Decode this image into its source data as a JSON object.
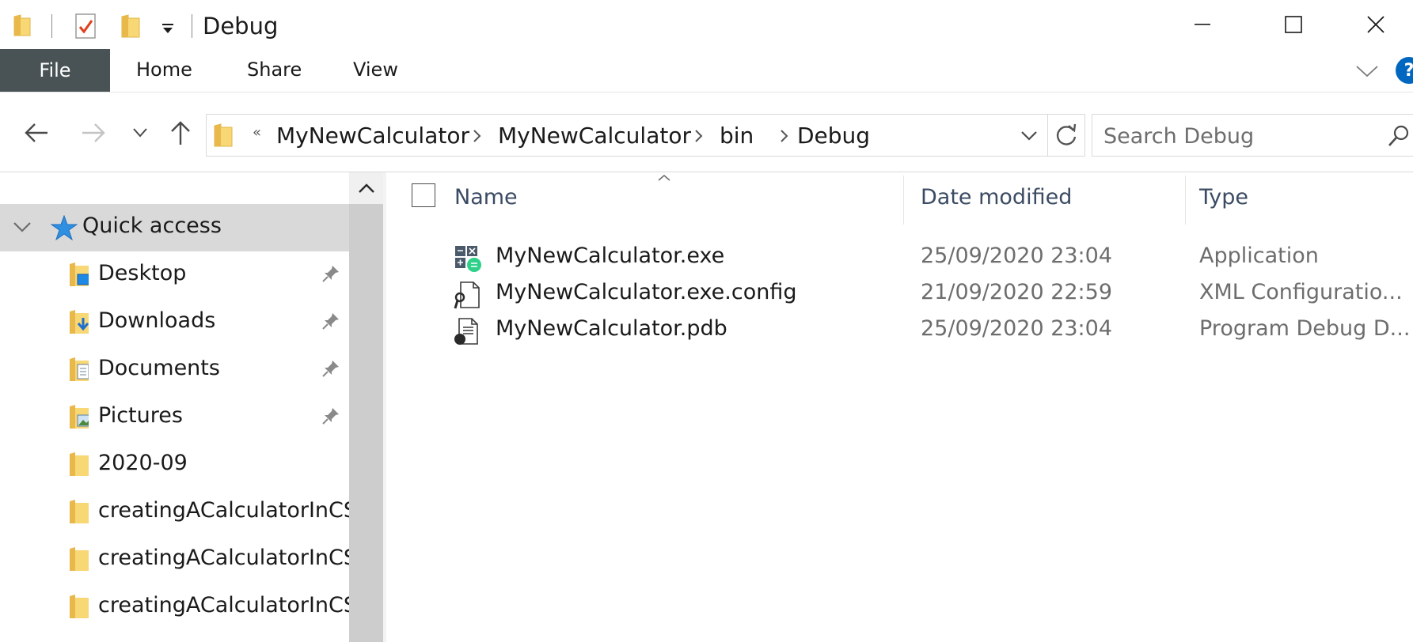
{
  "window": {
    "title": "Debug",
    "minimize_glyph": "—",
    "maximize_glyph": "☐",
    "close_glyph": "✕"
  },
  "ribbon": {
    "tabs": [
      {
        "label": "File"
      },
      {
        "label": "Home"
      },
      {
        "label": "Share"
      },
      {
        "label": "View"
      }
    ],
    "help_glyph": "?"
  },
  "address": {
    "overflow": "«",
    "crumbs": [
      "MyNewCalculator",
      "MyNewCalculator",
      "bin",
      "Debug"
    ]
  },
  "search": {
    "placeholder": "Search Debug"
  },
  "nav": {
    "quick_access": "Quick access",
    "items": [
      {
        "label": "Desktop",
        "pinned": true,
        "icon": "desktop-folder-icon"
      },
      {
        "label": "Downloads",
        "pinned": true,
        "icon": "downloads-folder-icon"
      },
      {
        "label": "Documents",
        "pinned": true,
        "icon": "documents-folder-icon"
      },
      {
        "label": "Pictures",
        "pinned": true,
        "icon": "pictures-folder-icon"
      },
      {
        "label": "2020-09",
        "pinned": false,
        "icon": "folder-icon"
      },
      {
        "label": "creatingACalculatorInCS",
        "pinned": false,
        "icon": "folder-icon"
      },
      {
        "label": "creatingACalculatorInCS",
        "pinned": false,
        "icon": "folder-icon"
      },
      {
        "label": "creatingACalculatorInCS",
        "pinned": false,
        "icon": "folder-icon"
      }
    ]
  },
  "files": {
    "columns": {
      "name": "Name",
      "date": "Date modified",
      "type": "Type"
    },
    "rows": [
      {
        "name": "MyNewCalculator.exe",
        "date": "25/09/2020 23:04",
        "type": "Application",
        "icon": "calculator-app-icon"
      },
      {
        "name": "MyNewCalculator.exe.config",
        "date": "21/09/2020 22:59",
        "type": "XML Configuratio...",
        "icon": "config-file-icon"
      },
      {
        "name": "MyNewCalculator.pdb",
        "date": "25/09/2020 23:04",
        "type": "Program Debug D...",
        "icon": "pdb-file-icon"
      }
    ]
  },
  "colors": {
    "file_tab": "#495355",
    "accent_blue": "#0067c0",
    "folder_yellow": "#f8d775",
    "selection_gray": "#d9d9d9"
  }
}
